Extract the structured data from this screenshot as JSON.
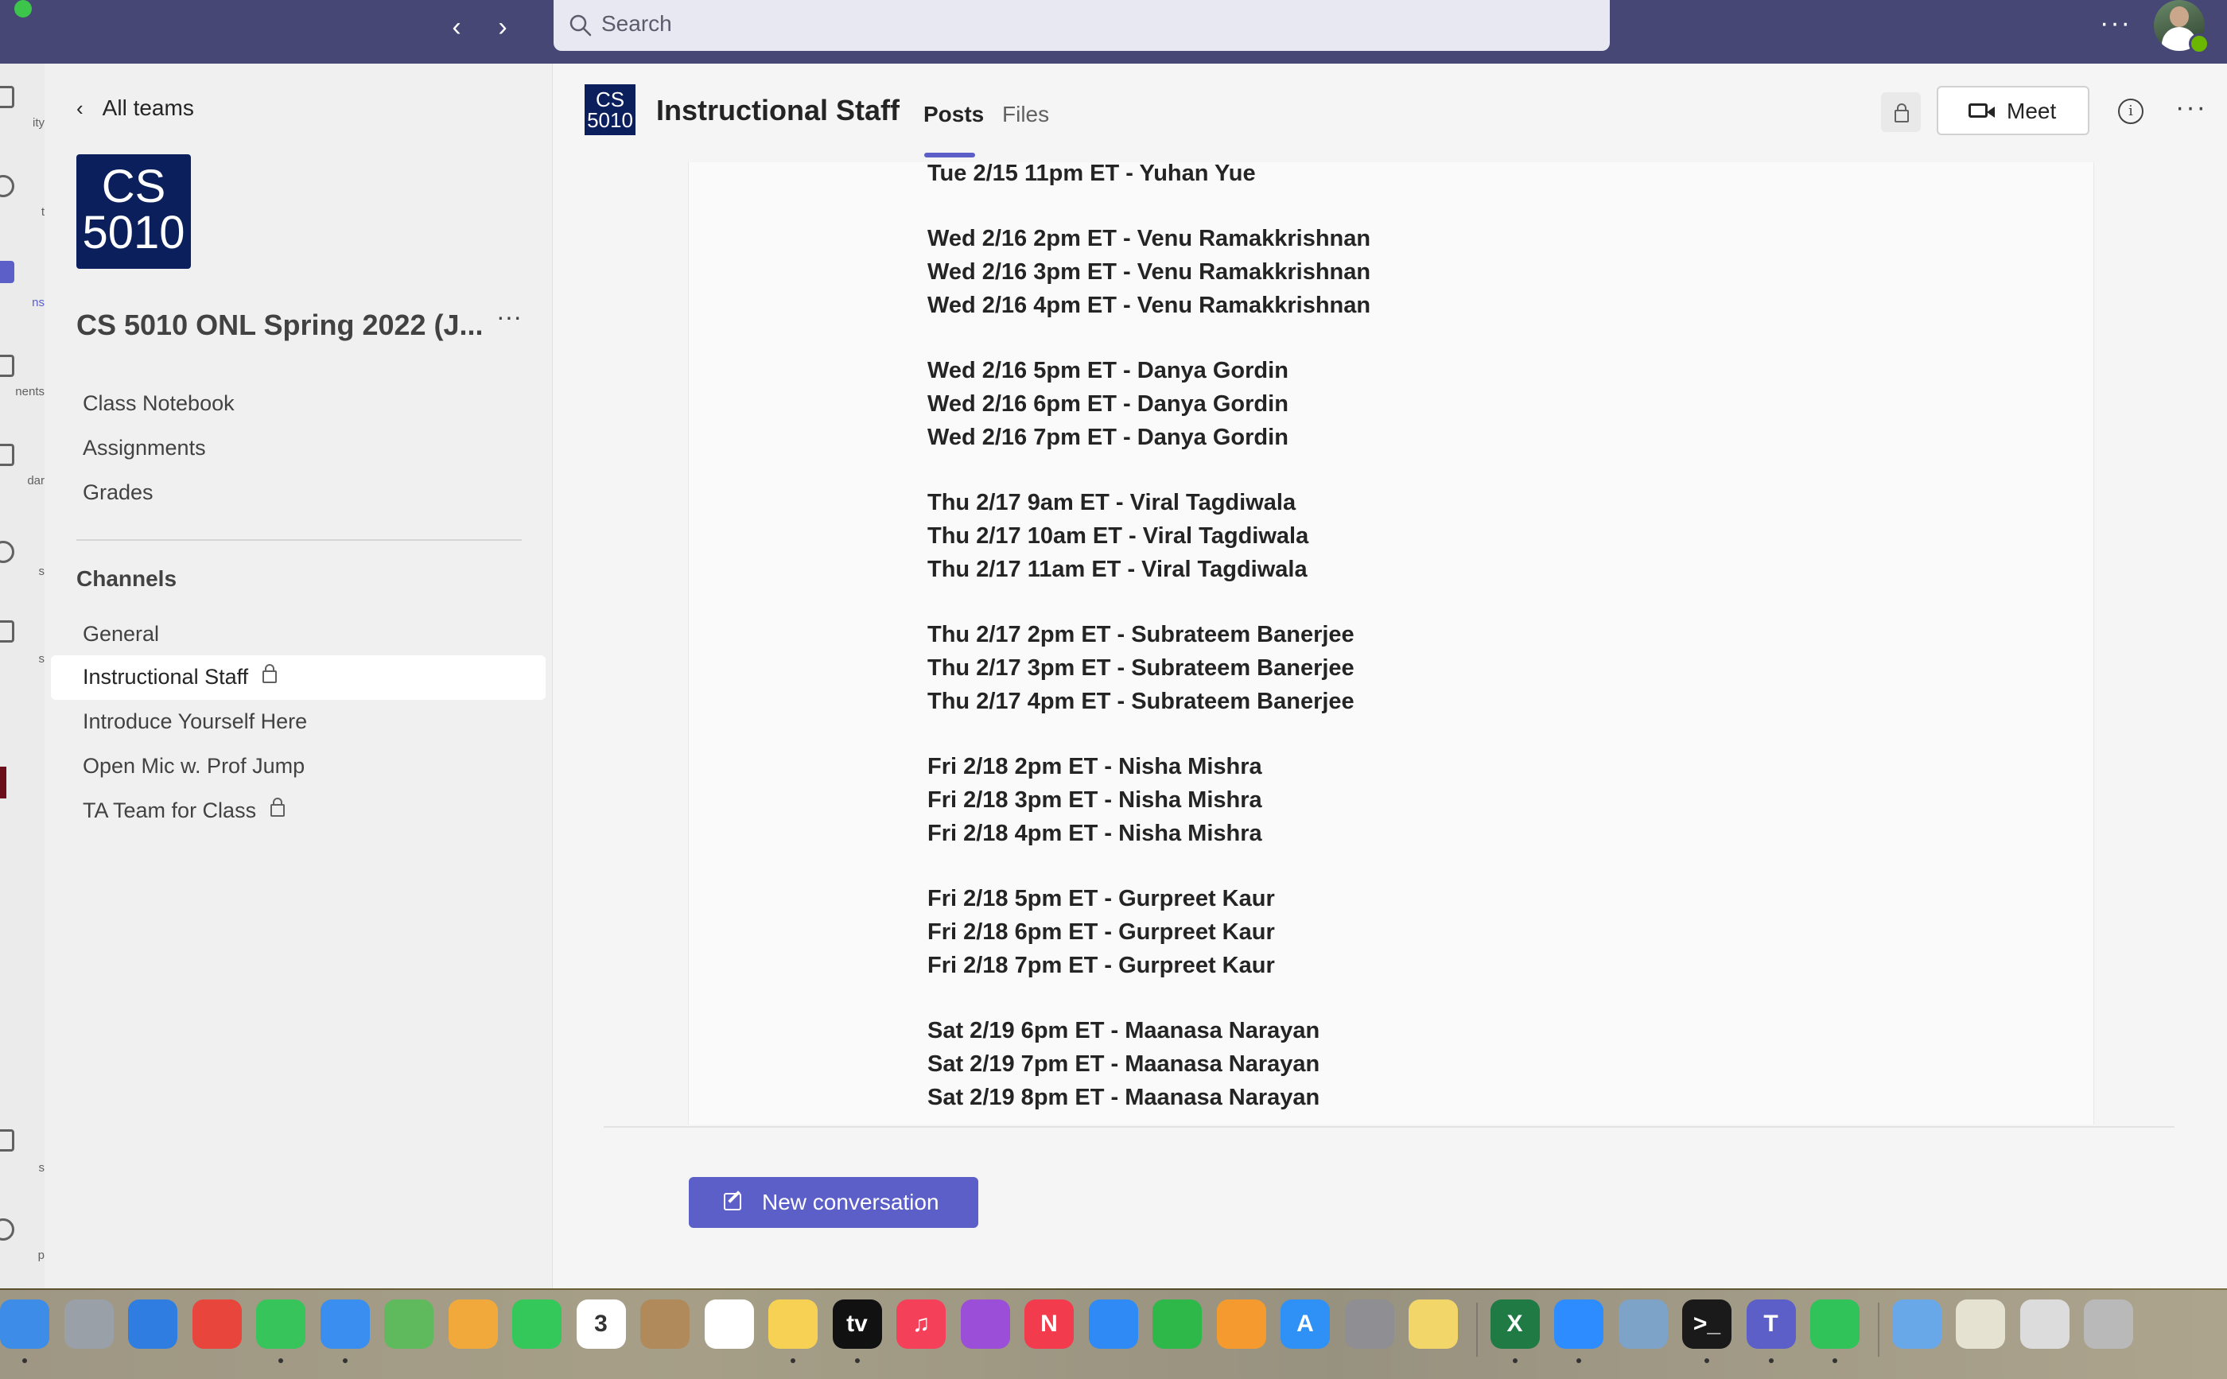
{
  "search": {
    "placeholder": "Search"
  },
  "topbar": {
    "more": "···"
  },
  "rail": {
    "items": [
      {
        "label": "ity"
      },
      {
        "label": "t"
      },
      {
        "label": "ns"
      },
      {
        "label": "nents"
      },
      {
        "label": "dar"
      },
      {
        "label": "s"
      },
      {
        "label": "s"
      },
      {
        "label": "s"
      },
      {
        "label": "p"
      }
    ]
  },
  "team": {
    "back_label": "All teams",
    "logo_line1": "CS",
    "logo_line2": "5010",
    "name": "CS 5010 ONL Spring 2022 (J...",
    "more": "···",
    "links": [
      "Class Notebook",
      "Assignments",
      "Grades"
    ],
    "channels_header": "Channels",
    "channels": [
      {
        "label": "General",
        "locked": false
      },
      {
        "label": "Instructional Staff",
        "locked": true,
        "active": true
      },
      {
        "label": "Introduce Yourself Here",
        "locked": false
      },
      {
        "label": "Open Mic w. Prof Jump",
        "locked": false
      },
      {
        "label": "TA Team for Class",
        "locked": true
      }
    ]
  },
  "channel_header": {
    "logo_line1": "CS",
    "logo_line2": "5010",
    "title": "Instructional Staff",
    "tabs": [
      "Posts",
      "Files"
    ],
    "meet_label": "Meet",
    "info": "i",
    "more": "···"
  },
  "message": {
    "lines": [
      "Tue 2/15 11pm ET - Yuhan Yue",
      "",
      "Wed 2/16 2pm ET - Venu Ramakkrishnan",
      "Wed 2/16 3pm ET - Venu Ramakkrishnan",
      "Wed 2/16 4pm ET - Venu Ramakkrishnan",
      "",
      "Wed 2/16 5pm ET - Danya Gordin",
      "Wed 2/16 6pm ET - Danya Gordin",
      "Wed 2/16 7pm ET - Danya Gordin",
      "",
      "Thu 2/17 9am ET - Viral Tagdiwala",
      "Thu 2/17 10am ET - Viral Tagdiwala",
      "Thu 2/17 11am ET - Viral Tagdiwala",
      "",
      "Thu 2/17 2pm ET - Subrateem Banerjee",
      "Thu 2/17 3pm ET - Subrateem Banerjee",
      "Thu 2/17 4pm ET - Subrateem Banerjee",
      "",
      "Fri 2/18 2pm ET - Nisha Mishra",
      "Fri 2/18 3pm ET - Nisha Mishra",
      "Fri 2/18 4pm ET - Nisha Mishra",
      "",
      "Fri 2/18 5pm ET - Gurpreet Kaur",
      "Fri 2/18 6pm ET - Gurpreet Kaur",
      "Fri 2/18 7pm ET - Gurpreet Kaur",
      "",
      "Sat 2/19 6pm ET - Maanasa Narayan",
      "Sat 2/19 7pm ET - Maanasa Narayan",
      "Sat 2/19 8pm ET - Maanasa Narayan"
    ]
  },
  "composer": {
    "new_conversation_label": "New conversation"
  },
  "dock": {
    "apps": [
      {
        "name": "finder-icon",
        "color": "#3d8ce8",
        "glyph": ""
      },
      {
        "name": "launchpad-icon",
        "color": "#9aa0a8",
        "glyph": ""
      },
      {
        "name": "safari-icon",
        "color": "#2f7de0",
        "glyph": ""
      },
      {
        "name": "chrome-icon",
        "color": "#e8453c",
        "glyph": ""
      },
      {
        "name": "messages-icon",
        "color": "#37c45a",
        "glyph": ""
      },
      {
        "name": "mail-icon",
        "color": "#3a8ef0",
        "glyph": ""
      },
      {
        "name": "maps-icon",
        "color": "#5fb95d",
        "glyph": ""
      },
      {
        "name": "photos-icon",
        "color": "#f2a93b",
        "glyph": ""
      },
      {
        "name": "facetime-icon",
        "color": "#34c759",
        "glyph": ""
      },
      {
        "name": "calendar-icon",
        "color": "#ffffff",
        "glyph": "3"
      },
      {
        "name": "contacts-icon",
        "color": "#b08a5a",
        "glyph": ""
      },
      {
        "name": "reminders-icon",
        "color": "#ffffff",
        "glyph": ""
      },
      {
        "name": "notes-icon",
        "color": "#f7d154",
        "glyph": ""
      },
      {
        "name": "tv-icon",
        "color": "#111111",
        "glyph": "tv"
      },
      {
        "name": "music-icon",
        "color": "#f5405a",
        "glyph": "♫"
      },
      {
        "name": "podcasts-icon",
        "color": "#9b4fd8",
        "glyph": ""
      },
      {
        "name": "news-icon",
        "color": "#f23b4d",
        "glyph": "N"
      },
      {
        "name": "keynote-icon",
        "color": "#2f8af5",
        "glyph": ""
      },
      {
        "name": "numbers-icon",
        "color": "#2fb84a",
        "glyph": ""
      },
      {
        "name": "pages-icon",
        "color": "#f59a2f",
        "glyph": ""
      },
      {
        "name": "appstore-icon",
        "color": "#2f90f5",
        "glyph": "A"
      },
      {
        "name": "settings-icon",
        "color": "#8e8e93",
        "glyph": ""
      },
      {
        "name": "stickies-icon",
        "color": "#f3d66a",
        "glyph": ""
      },
      {
        "name": "excel-icon",
        "color": "#1f7a44",
        "glyph": "X"
      },
      {
        "name": "zoom-icon",
        "color": "#2d8cff",
        "glyph": ""
      },
      {
        "name": "preview-icon",
        "color": "#7da3c9",
        "glyph": ""
      },
      {
        "name": "terminal-icon",
        "color": "#1a1a1a",
        "glyph": ">_"
      },
      {
        "name": "teams-icon",
        "color": "#5b5fc7",
        "glyph": "T"
      },
      {
        "name": "whatsapp-icon",
        "color": "#2fc35a",
        "glyph": ""
      },
      {
        "name": "downloads-folder-icon",
        "color": "#69a8e8",
        "glyph": ""
      },
      {
        "name": "stack-icon",
        "color": "#e6e2d2",
        "glyph": ""
      },
      {
        "name": "stack-2-icon",
        "color": "#dcdcdc",
        "glyph": ""
      },
      {
        "name": "trash-icon",
        "color": "#b9b9b9",
        "glyph": ""
      }
    ]
  }
}
